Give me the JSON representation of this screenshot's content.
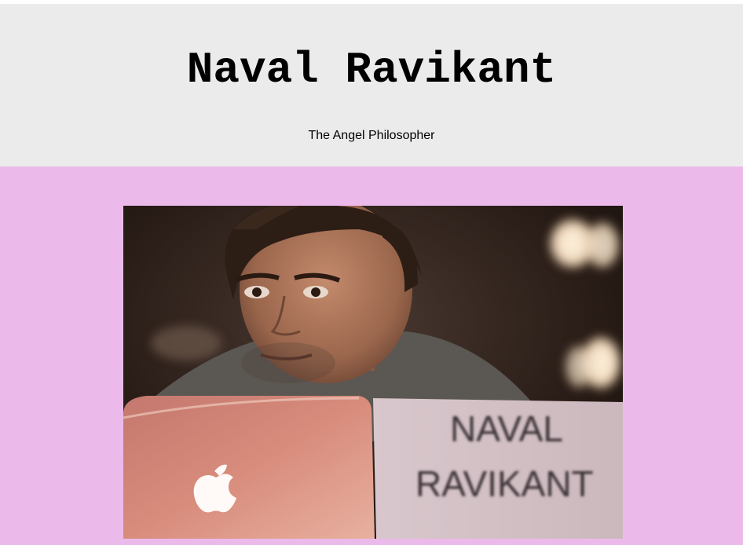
{
  "header": {
    "title": "Naval Ravikant",
    "subtitle": "The Angel Philosopher"
  },
  "main": {
    "photo": {
      "sign_line_1": "NAVAL",
      "sign_line_2": "RAVIKANT"
    }
  },
  "colors": {
    "header_background": "#ebebeb",
    "main_background": "#ebbaeb",
    "text": "#000000"
  },
  "icons": [
    "apple-logo-icon"
  ]
}
